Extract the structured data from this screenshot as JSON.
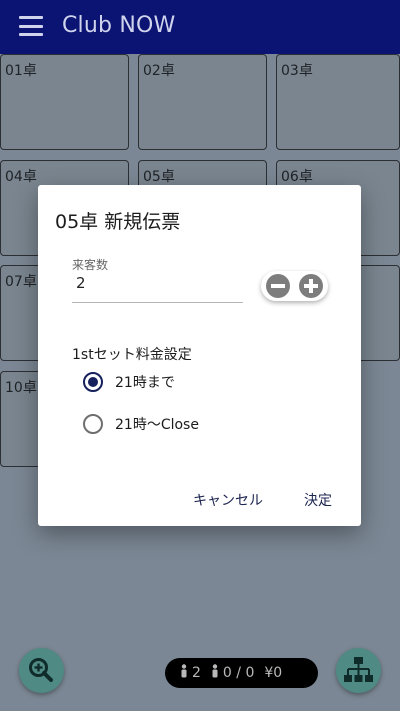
{
  "header": {
    "title": "Club NOW",
    "menu_icon": "hamburger-menu-icon"
  },
  "tables": [
    {
      "label": "01卓"
    },
    {
      "label": "02卓"
    },
    {
      "label": "03卓"
    },
    {
      "label": "04卓"
    },
    {
      "label": "05卓"
    },
    {
      "label": "06卓"
    },
    {
      "label": "07卓"
    },
    {
      "label": "10卓"
    }
  ],
  "dialog": {
    "title": "05卓 新規伝票",
    "guest_count_label": "来客数",
    "guest_count_value": "2",
    "set_section_label": "1stセット料金設定",
    "options": [
      {
        "label": "21時まで",
        "selected": true
      },
      {
        "label": "21時〜Close",
        "selected": false
      }
    ],
    "cancel_label": "キャンセル",
    "confirm_label": "決定"
  },
  "footer": {
    "stat_guests": "2",
    "stat_ratio": "0 / 0",
    "stat_amount": "¥0",
    "zoom_icon": "zoom-in-icon",
    "org_icon": "sitemap-icon"
  },
  "colors": {
    "appbar": "#0b1373",
    "overlay": "#7b8794",
    "accent": "#16205c",
    "fab": "#4f8a84"
  }
}
